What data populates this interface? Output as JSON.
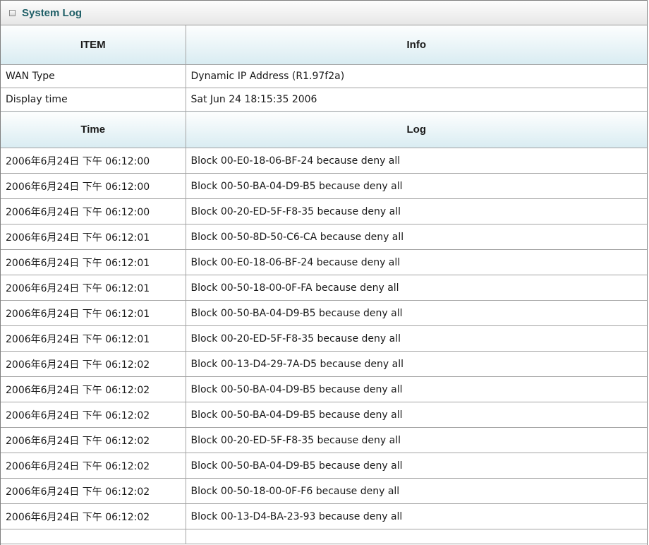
{
  "panel": {
    "title": "System Log"
  },
  "info_table": {
    "headers": [
      "ITEM",
      "Info"
    ],
    "rows": [
      {
        "item": "WAN Type",
        "info": "Dynamic IP Address (R1.97f2a)"
      },
      {
        "item": "Display time",
        "info": "Sat Jun 24 18:15:35 2006"
      }
    ]
  },
  "log_table": {
    "headers": [
      "Time",
      "Log"
    ],
    "rows": [
      {
        "time": "2006年6月24日 下午 06:12:00",
        "log": "Block 00-E0-18-06-BF-24 because deny all"
      },
      {
        "time": "2006年6月24日 下午 06:12:00",
        "log": "Block 00-50-BA-04-D9-B5 because deny all"
      },
      {
        "time": "2006年6月24日 下午 06:12:00",
        "log": "Block 00-20-ED-5F-F8-35 because deny all"
      },
      {
        "time": "2006年6月24日 下午 06:12:01",
        "log": "Block 00-50-8D-50-C6-CA because deny all"
      },
      {
        "time": "2006年6月24日 下午 06:12:01",
        "log": "Block 00-E0-18-06-BF-24 because deny all"
      },
      {
        "time": "2006年6月24日 下午 06:12:01",
        "log": "Block 00-50-18-00-0F-FA because deny all"
      },
      {
        "time": "2006年6月24日 下午 06:12:01",
        "log": "Block 00-50-BA-04-D9-B5 because deny all"
      },
      {
        "time": "2006年6月24日 下午 06:12:01",
        "log": "Block 00-20-ED-5F-F8-35 because deny all"
      },
      {
        "time": "2006年6月24日 下午 06:12:02",
        "log": "Block 00-13-D4-29-7A-D5 because deny all"
      },
      {
        "time": "2006年6月24日 下午 06:12:02",
        "log": "Block 00-50-BA-04-D9-B5 because deny all"
      },
      {
        "time": "2006年6月24日 下午 06:12:02",
        "log": "Block 00-50-BA-04-D9-B5 because deny all"
      },
      {
        "time": "2006年6月24日 下午 06:12:02",
        "log": "Block 00-20-ED-5F-F8-35 because deny all"
      },
      {
        "time": "2006年6月24日 下午 06:12:02",
        "log": "Block 00-50-BA-04-D9-B5 because deny all"
      },
      {
        "time": "2006年6月24日 下午 06:12:02",
        "log": "Block 00-50-18-00-0F-F6 because deny all"
      },
      {
        "time": "2006年6月24日 下午 06:12:02",
        "log": "Block 00-13-D4-BA-23-93 because deny all"
      }
    ]
  },
  "colors": {
    "title": "#1f5f67",
    "header_bg_bottom": "#d9ecf2",
    "border": "#a3a3a3"
  }
}
